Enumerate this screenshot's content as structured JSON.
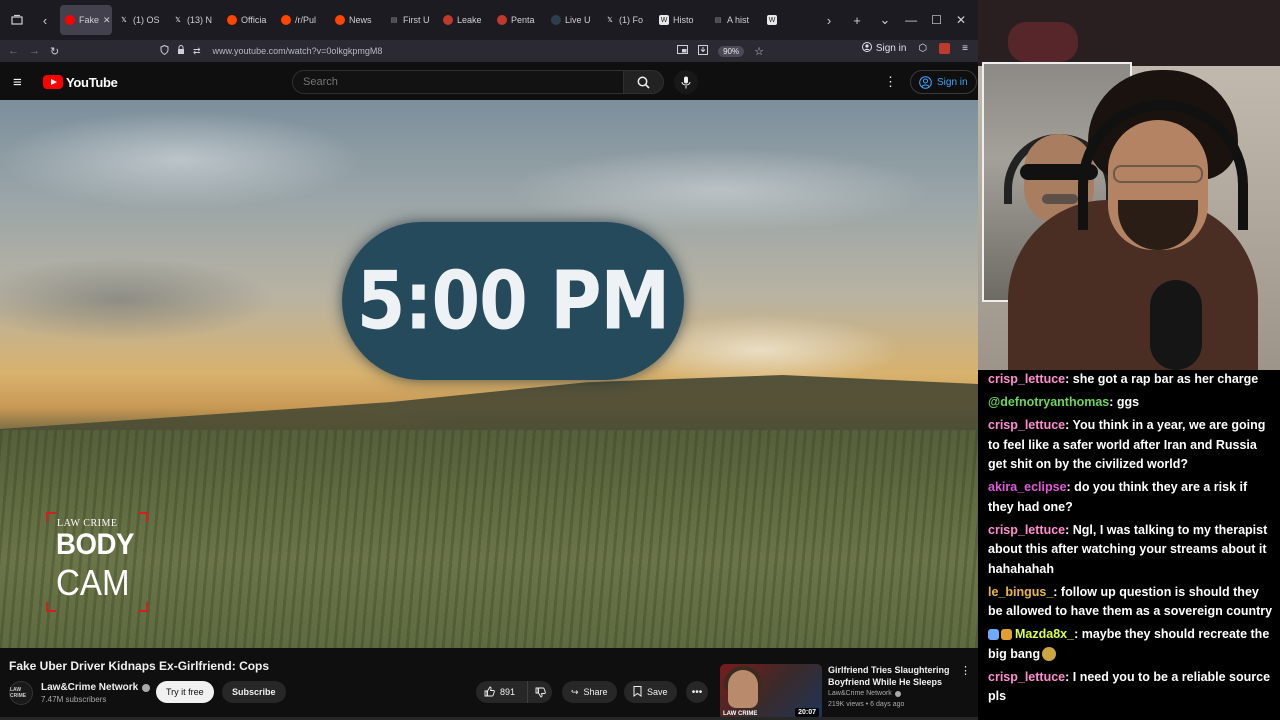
{
  "browser": {
    "tabs": [
      {
        "label": "Fake",
        "active": true,
        "icon": "youtube-icon",
        "color": "#ff0000",
        "closable": true
      },
      {
        "label": "(1) OS",
        "active": false,
        "icon": "x-icon",
        "color": "#ffffff"
      },
      {
        "label": "(13) N",
        "active": false,
        "icon": "x-icon",
        "color": "#ffffff"
      },
      {
        "label": "Officia",
        "active": false,
        "icon": "reddit-icon",
        "color": "#ff4500"
      },
      {
        "label": "/r/Pul",
        "active": false,
        "icon": "reddit-icon",
        "color": "#ff4500"
      },
      {
        "label": "News",
        "active": false,
        "icon": "reddit-icon",
        "color": "#ff4500"
      },
      {
        "label": "First U",
        "active": false,
        "icon": "page-icon",
        "color": "#9a9aa5"
      },
      {
        "label": "Leake",
        "active": false,
        "icon": "circle-icon",
        "color": "#c0392b"
      },
      {
        "label": "Penta",
        "active": false,
        "icon": "circle-icon",
        "color": "#c0392b"
      },
      {
        "label": "Live U",
        "active": false,
        "icon": "map-icon",
        "color": "#2c3e50"
      },
      {
        "label": "(1) Fo",
        "active": false,
        "icon": "x-icon",
        "color": "#ffffff"
      },
      {
        "label": "Histo",
        "active": false,
        "icon": "wikipedia-icon",
        "color": "#ffffff"
      },
      {
        "label": "A hist",
        "active": false,
        "icon": "page-icon",
        "color": "#9a9aa5"
      },
      {
        "label": "",
        "active": false,
        "icon": "wikipedia-icon",
        "color": "#ffffff"
      }
    ],
    "url": "www.youtube.com/watch?v=0olkgkpmgM8",
    "zoom": "90%",
    "signin_label": "Sign in"
  },
  "youtube": {
    "logo_text": "YouTube",
    "search_placeholder": "Search",
    "signin_label": "Sign in",
    "video": {
      "overlay_time": "5:00 PM",
      "bodycam_brand": "LAW CRIME",
      "bodycam_line1": "BODY",
      "bodycam_line2": "CAM"
    },
    "title": "Fake Uber Driver Kidnaps Ex-Girlfriend: Cops",
    "channel": {
      "name": "Law&Crime Network",
      "subscribers": "7.47M subscribers",
      "avatar_text": "LAW CRIME"
    },
    "buttons": {
      "try_label": "Try it free",
      "subscribe_label": "Subscribe",
      "like_count": "891",
      "share_label": "Share",
      "save_label": "Save"
    },
    "recommendation": {
      "title": "Girlfriend Tries Slaughtering Boyfriend While He Sleeps",
      "channel": "Law&Crime Network",
      "meta": "219K views • 6 days ago",
      "duration": "20:07",
      "thumb_badge": "LAW CRIME"
    }
  },
  "chat": {
    "messages": [
      {
        "user": "crisp_lettuce",
        "user_class": "u-crisp",
        "text": ": she got a rap bar as her charge"
      },
      {
        "user": "@defnotryanthomas",
        "user_class": "u-defno",
        "text": ": ggs"
      },
      {
        "user": "crisp_lettuce",
        "user_class": "u-crisp",
        "text": ": You think in a year, we are going to feel like a safer world after Iran and Russia get shit on by the civilized world?"
      },
      {
        "user": "akira_eclipse",
        "user_class": "u-akira",
        "text": ": do you think they are a risk if they had one?"
      },
      {
        "user": "crisp_lettuce",
        "user_class": "u-crisp",
        "text": ": Ngl, I was talking to my therapist about this after watching your streams about it hahahahah"
      },
      {
        "user": "le_bingus_",
        "user_class": "u-bingus",
        "text": ": follow up question is should they be allowed to have them as a sovereign country"
      },
      {
        "user": "Mazda8x_",
        "user_class": "u-mazda",
        "text": ": maybe they should recreate the big bang",
        "badges": [
          "#6fa8ff",
          "#e0a030"
        ],
        "emote": true
      },
      {
        "user": "crisp_lettuce",
        "user_class": "u-crisp",
        "text": ": I need you to be a reliable source pls"
      }
    ]
  }
}
